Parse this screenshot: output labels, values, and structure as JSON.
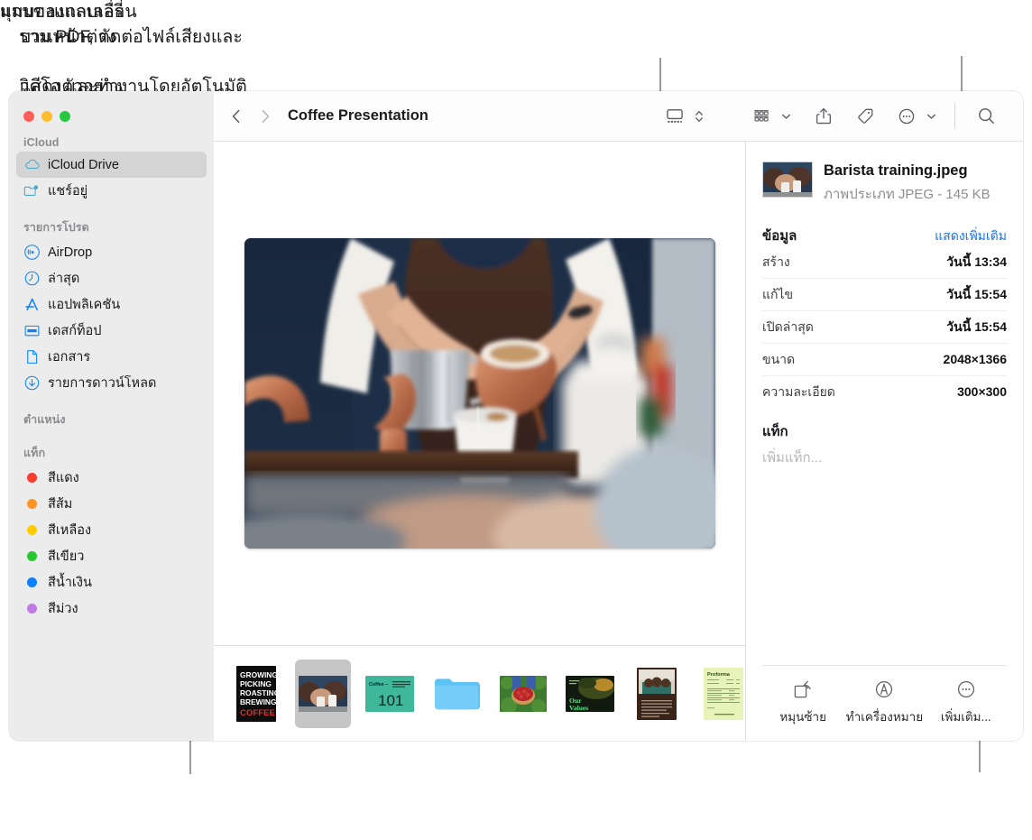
{
  "annotations": {
    "gallery_view": "มุมมองแกลเลอรี่",
    "preview_pane_line1": "บานหน้าต่าง",
    "preview_pane_line2": "แสดงตัวอย่าง",
    "filmstrip": "แถบของแถบเลื่อน",
    "more_line1": "รวม PDF, ตัดต่อไฟล์เสียงและ",
    "more_line2": "วิดีโอ และทำงานโดยอัตโนมัติ"
  },
  "window": {
    "traffic_lights": [
      "close",
      "minimize",
      "zoom"
    ]
  },
  "toolbar": {
    "title": "Coffee Presentation",
    "back_icon": "chevron-left-icon",
    "forward_icon": "chevron-right-icon",
    "view_icon": "gallery-view-icon",
    "view_stepper_icon": "up-down-chevron-icon",
    "group_icon": "group-items-icon",
    "group_chevron_icon": "chevron-down-icon",
    "share_icon": "share-icon",
    "tag_icon": "tag-icon",
    "more_icon": "ellipsis-circle-icon",
    "more_chevron_icon": "chevron-down-icon",
    "search_icon": "search-icon"
  },
  "sidebar": {
    "sections": [
      {
        "title": "iCloud",
        "items": [
          {
            "label": "iCloud Drive",
            "icon": "cloud-icon",
            "selected": true
          },
          {
            "label": "แชร์อยู่",
            "icon": "shared-folder-icon",
            "selected": false
          }
        ]
      },
      {
        "title": "รายการโปรด",
        "items": [
          {
            "label": "AirDrop",
            "icon": "airdrop-icon",
            "selected": false
          },
          {
            "label": "ล่าสุด",
            "icon": "clock-icon",
            "selected": false
          },
          {
            "label": "แอปพลิเคชัน",
            "icon": "applications-icon",
            "selected": false
          },
          {
            "label": "เดสก์ท็อป",
            "icon": "desktop-icon",
            "selected": false
          },
          {
            "label": "เอกสาร",
            "icon": "document-icon",
            "selected": false
          },
          {
            "label": "รายการดาวน์โหลด",
            "icon": "downloads-icon",
            "selected": false
          }
        ]
      },
      {
        "title": "ตำแหน่ง",
        "items": []
      },
      {
        "title": "แท็ก",
        "items": [
          {
            "label": "สีแดง",
            "icon": "tag-dot-icon",
            "color": "#fc3b30",
            "selected": false
          },
          {
            "label": "สีส้ม",
            "icon": "tag-dot-icon",
            "color": "#fd9426",
            "selected": false
          },
          {
            "label": "สีเหลือง",
            "icon": "tag-dot-icon",
            "color": "#fecc00",
            "selected": false
          },
          {
            "label": "สีเขียว",
            "icon": "tag-dot-icon",
            "color": "#29c732",
            "selected": false
          },
          {
            "label": "สีน้ำเงิน",
            "icon": "tag-dot-icon",
            "color": "#0a82ff",
            "selected": false
          },
          {
            "label": "สีม่วง",
            "icon": "tag-dot-icon",
            "color": "#c07ae4",
            "selected": false
          }
        ]
      }
    ]
  },
  "preview": {
    "hero_alt": "barista-pouring-coffee-photo"
  },
  "filmstrip": {
    "items": [
      {
        "name": "growing-picking-roasting-brewing-coffee-poster",
        "selected": false,
        "lines": [
          "GROWING",
          "PICKING",
          "ROASTING",
          "BREWING",
          "COFFEE"
        ]
      },
      {
        "name": "barista-training-photo",
        "selected": true
      },
      {
        "name": "coffee-101-slide",
        "selected": false,
        "title": "Coffee –",
        "big": "101"
      },
      {
        "name": "folder",
        "selected": false
      },
      {
        "name": "coffee-cherries-basket-photo",
        "selected": false
      },
      {
        "name": "our-values-slide",
        "selected": false,
        "line1": "Our",
        "line2": "Values"
      },
      {
        "name": "meeting-document",
        "selected": false
      },
      {
        "name": "invoice-document",
        "selected": false,
        "header": "Proforma"
      }
    ]
  },
  "info_panel": {
    "file_name": "Barista training.jpeg",
    "file_kind": "ภาพประเภท JPEG - 145 KB",
    "info_title": "ข้อมูล",
    "show_more": "แสดงเพิ่มเติม",
    "rows": [
      {
        "key": "สร้าง",
        "value": "วันนี้ 13:34"
      },
      {
        "key": "แก้ไข",
        "value": "วันนี้ 15:54"
      },
      {
        "key": "เปิดล่าสุด",
        "value": "วันนี้ 15:54"
      },
      {
        "key": "ขนาด",
        "value": "2048×1366"
      },
      {
        "key": "ความละเอียด",
        "value": "300×300"
      }
    ],
    "tags_title": "แท็ก",
    "tags_placeholder": "เพิ่มแท็ก...",
    "quick_actions": [
      {
        "label": "หมุนซ้าย",
        "icon": "rotate-left-icon"
      },
      {
        "label": "ทำเครื่องหมาย",
        "icon": "markup-icon"
      },
      {
        "label": "เพิ่มเติม...",
        "icon": "ellipsis-circle-icon"
      }
    ]
  },
  "colors": {
    "accent_link": "#1b72e8",
    "sidebar_bg": "#ececec",
    "selection": "#d4d4d4"
  }
}
